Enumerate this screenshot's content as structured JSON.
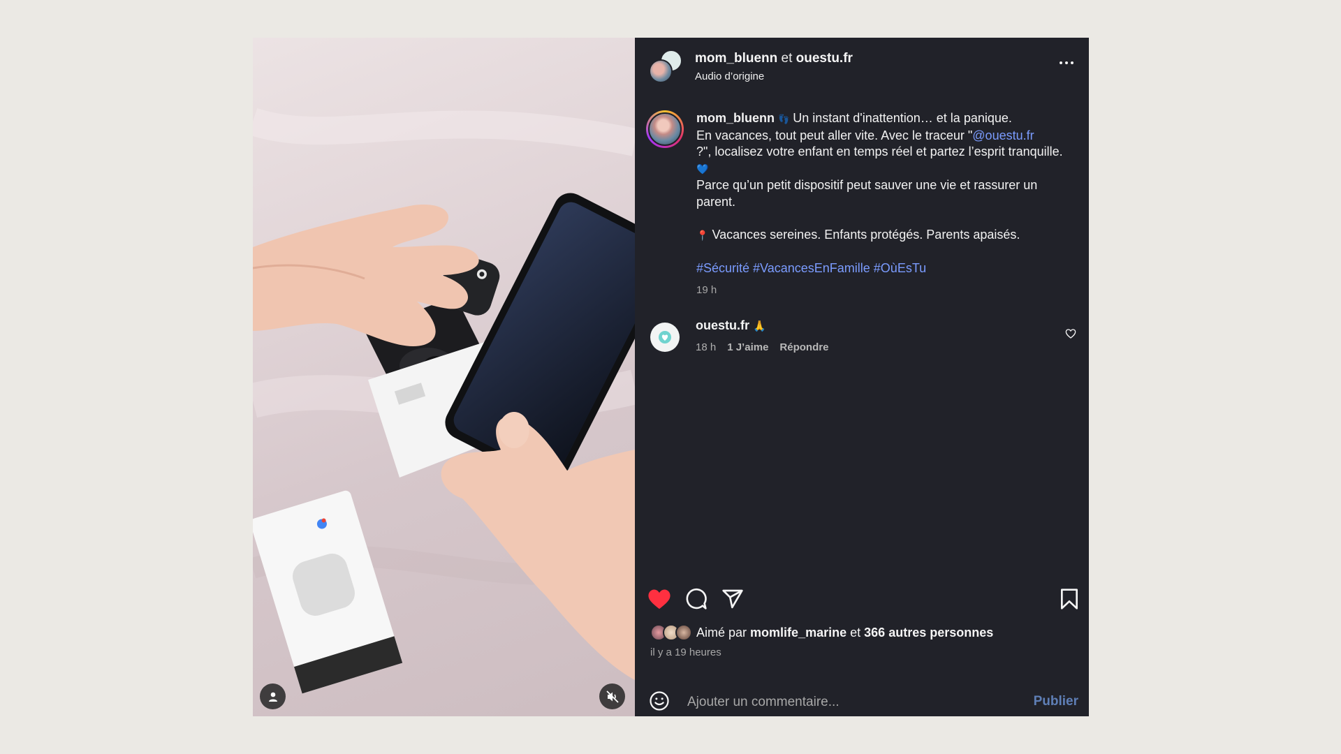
{
  "header": {
    "user1": "mom_bluenn",
    "connector": "et",
    "user2": "ouestu.fr",
    "audio": "Audio d’origine"
  },
  "caption": {
    "username": "mom_bluenn",
    "line1_emoji": "👣",
    "line1": "Un instant d'inattention… et la panique.",
    "line2_pre": "En vacances, tout peut aller vite. Avec le traceur \"",
    "mention": "@ouestu.fr",
    "line3": "?\", localisez votre enfant en temps réel et partez l’esprit tranquille.",
    "line3_emoji": "💙",
    "line4": "Parce qu’un petit dispositif peut sauver une vie et rassurer un parent.",
    "line5_emoji": "📍",
    "line5": "Vacances sereines. Enfants protégés. Parents apaisés.",
    "hashtags": "#Sécurité #VacancesEnFamille #OùEsTu",
    "time": "19 h"
  },
  "comment": {
    "username": "ouestu.fr",
    "emoji": "🙏",
    "time": "18 h",
    "likes": "1 J’aime",
    "reply": "Répondre"
  },
  "likes": {
    "prefix": "Aimé par",
    "user": "momlife_marine",
    "connector": "et",
    "others": "366 autres personnes",
    "ago": "il y a 19 heures"
  },
  "comment_box": {
    "placeholder": "Ajouter un commentaire...",
    "publish": "Publier"
  },
  "colors": {
    "panel_bg": "#212229",
    "like_red": "#ff3040",
    "link_blue": "#7b9cff",
    "publish_blue": "#5f7fb6"
  },
  "icons": [
    "more-icon",
    "heart-icon",
    "comment-icon",
    "share-icon",
    "bookmark-icon",
    "emoji-icon",
    "user-tag-icon",
    "mute-icon"
  ]
}
